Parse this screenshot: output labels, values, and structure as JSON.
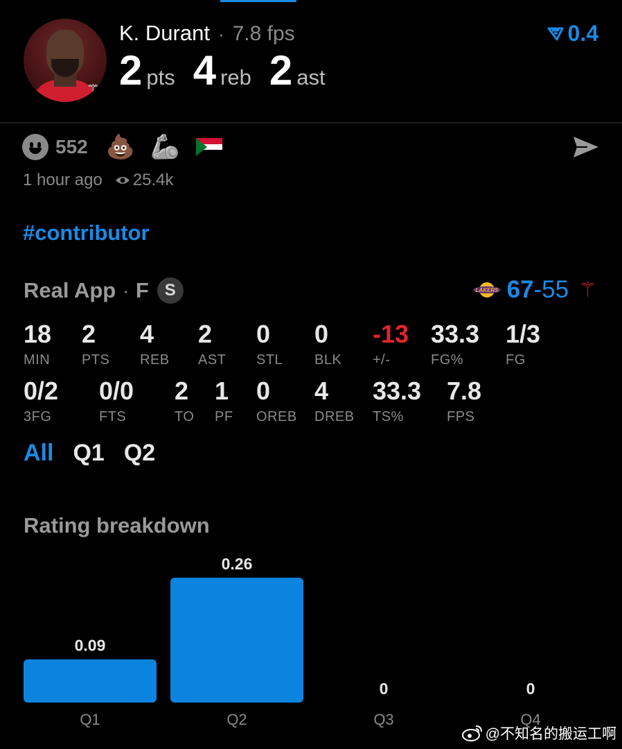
{
  "header": {
    "player_name": "K. Durant",
    "separator": "·",
    "fps_label": "7.8 fps",
    "stats": [
      {
        "value": "2",
        "unit": "pts"
      },
      {
        "value": "4",
        "unit": "reb"
      },
      {
        "value": "2",
        "unit": "ast"
      }
    ],
    "rating": "0.4",
    "accent_color": "#1a8ae6"
  },
  "reactions": {
    "count": "552",
    "emojis": [
      "💩",
      "🦾"
    ],
    "icons": [
      "smiley-icon",
      "poop-emoji",
      "mechanical-arm-emoji",
      "sudan-flag-icon",
      "send-icon"
    ]
  },
  "meta": {
    "time": "1 hour ago",
    "views": "25.4k"
  },
  "hashtag": "#contributor",
  "game": {
    "source": "Real App",
    "separator": "·",
    "position": "F",
    "badge": "S",
    "score_home": "67",
    "score_dash": "-",
    "score_away": "55"
  },
  "stat_grid": {
    "row1": [
      {
        "value": "18",
        "label": "MIN"
      },
      {
        "value": "2",
        "label": "PTS"
      },
      {
        "value": "4",
        "label": "REB"
      },
      {
        "value": "2",
        "label": "AST"
      },
      {
        "value": "0",
        "label": "STL"
      },
      {
        "value": "0",
        "label": "BLK"
      },
      {
        "value": "-13",
        "label": "+/-"
      },
      {
        "value": "33.3",
        "label": "FG%"
      },
      {
        "value": "1/3",
        "label": "FG"
      }
    ],
    "row2": [
      {
        "value": "0/2",
        "label": "3FG"
      },
      {
        "value": "0/0",
        "label": "FTS"
      },
      {
        "value": "2",
        "label": "TO"
      },
      {
        "value": "1",
        "label": "PF"
      },
      {
        "value": "0",
        "label": "OREB"
      },
      {
        "value": "4",
        "label": "DREB"
      },
      {
        "value": "33.3",
        "label": "TS%"
      },
      {
        "value": "7.8",
        "label": "FPS"
      }
    ]
  },
  "tabs": [
    {
      "label": "All",
      "active": true
    },
    {
      "label": "Q1",
      "active": false
    },
    {
      "label": "Q2",
      "active": false
    }
  ],
  "section_title": "Rating breakdown",
  "chart_data": {
    "type": "bar",
    "title": "Rating breakdown",
    "categories": [
      "Q1",
      "Q2",
      "Q3",
      "Q4"
    ],
    "values": [
      0.09,
      0.26,
      0,
      0
    ],
    "value_labels": [
      "0.09",
      "0.26",
      "0",
      "0"
    ],
    "bar_color": "#0b84e0",
    "grid": false,
    "legend": "none"
  },
  "watermark": "@不知名的搬运工啊"
}
